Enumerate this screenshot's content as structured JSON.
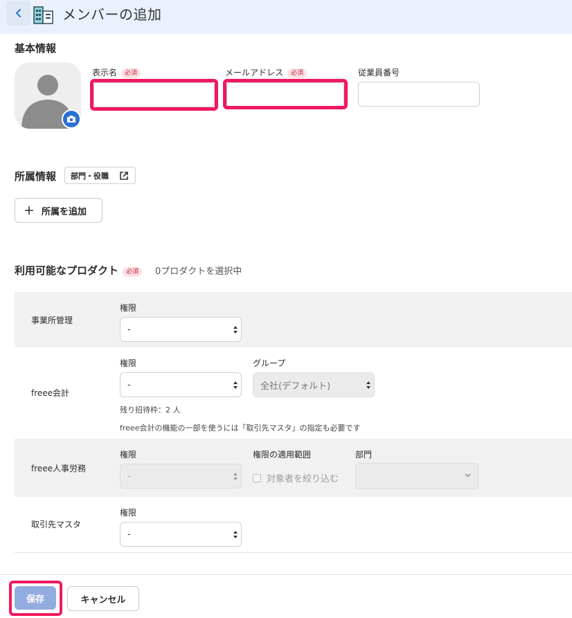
{
  "header": {
    "title": "メンバーの追加"
  },
  "basic": {
    "title": "基本情報",
    "display_name_label": "表示名",
    "email_label": "メールアドレス",
    "employee_no_label": "従業員番号",
    "required_badge": "必須"
  },
  "affiliation": {
    "title": "所属情報",
    "dept_role_button": "部門・役職",
    "add_button": "所属を追加"
  },
  "products": {
    "title": "利用可能なプロダクト",
    "required_badge": "必須",
    "selected_count": "0プロダクトを選択中",
    "rows": [
      {
        "name": "事業所管理",
        "permission_label": "権限",
        "permission_value": "-"
      },
      {
        "name": "freee会計",
        "permission_label": "権限",
        "permission_value": "-",
        "group_label": "グループ",
        "group_value": "全社(デフォルト)",
        "remaining": "残り招待枠：2 人",
        "note": "freee会計の機能の一部を使うには「取引先マスタ」の指定も必要です"
      },
      {
        "name": "freee人事労務",
        "permission_label": "権限",
        "permission_value": "-",
        "scope_label": "権限の適用範囲",
        "scope_checkbox": "対象者を絞り込む",
        "dept_label": "部門",
        "dept_value": ""
      },
      {
        "name": "取引先マスタ",
        "permission_label": "権限",
        "permission_value": "-"
      }
    ]
  },
  "footer": {
    "save": "保存",
    "cancel": "キャンセル"
  },
  "colors": {
    "accent": "#2b6fd6",
    "highlight": "#f0185f",
    "save_disabled": "#93acdf",
    "header_bg": "#eaf1fd"
  }
}
